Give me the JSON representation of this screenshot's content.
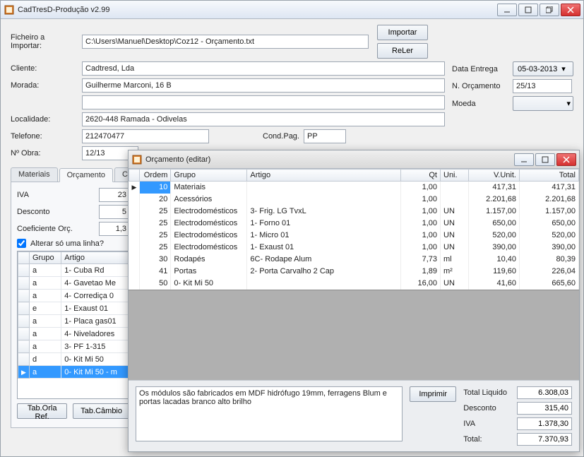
{
  "main": {
    "title": "CadTresD-Produção v2.99",
    "import_label": "Ficheiro a Importar:",
    "import_path": "C:\\Users\\Manuel\\Desktop\\Coz12 - Orçamento.txt",
    "btn_import": "Importar",
    "btn_reler": "ReLer",
    "labels": {
      "cliente": "Cliente:",
      "morada": "Morada:",
      "localidade": "Localidade:",
      "telefone": "Telefone:",
      "nobra": "Nº Obra:",
      "condpag": "Cond.Pag.",
      "data_entrega": "Data Entrega",
      "n_orcamento": "N. Orçamento",
      "moeda": "Moeda"
    },
    "fields": {
      "cliente": "Cadtresd, Lda",
      "morada1": "Guilherme Marconi, 16 B",
      "morada2": "",
      "localidade": "2620-448 Ramada - Odivelas",
      "telefone": "212470477",
      "condpag": "PP",
      "nobra": "12/13",
      "data_entrega": "05-03-2013",
      "n_orcamento": "25/13",
      "moeda": ""
    },
    "tabs": [
      "Materiais",
      "Orçamento",
      "Compor"
    ],
    "orc_panel": {
      "iva_label": "IVA",
      "iva": "23",
      "desconto_label": "Desconto",
      "desconto": "5",
      "coef_label": "Coeficiente Orç.",
      "coef": "1,3",
      "alterar_label": "Alterar só uma linha?",
      "cols": [
        "Grupo",
        "Artigo"
      ],
      "rows": [
        {
          "grupo": "a",
          "artigo": "1- Cuba Rd"
        },
        {
          "grupo": "a",
          "artigo": "4- Gavetao Me"
        },
        {
          "grupo": "a",
          "artigo": "4- Corrediça 0"
        },
        {
          "grupo": "e",
          "artigo": "1- Exaust 01"
        },
        {
          "grupo": "a",
          "artigo": "1- Placa gas01"
        },
        {
          "grupo": "a",
          "artigo": "4- Niveladores"
        },
        {
          "grupo": "a",
          "artigo": "3- PF 1-315"
        },
        {
          "grupo": "d",
          "artigo": "0- Kit Mi 50"
        },
        {
          "grupo": "a",
          "artigo": "0- Kit Mi 50 - m",
          "sel": true
        }
      ],
      "btn_tab_orla": "Tab.Orla Ref.",
      "btn_tab_cambio": "Tab.Câmbio"
    }
  },
  "sub": {
    "title": "Orçamento (editar)",
    "cols": {
      "ordem": "Ordem",
      "grupo": "Grupo",
      "artigo": "Artigo",
      "qt": "Qt",
      "uni": "Uni.",
      "vunit": "V.Unit.",
      "total": "Total"
    },
    "rows": [
      {
        "ordem": "10",
        "grupo": "Materiais",
        "artigo": "",
        "qt": "1,00",
        "uni": "",
        "vunit": "417,31",
        "total": "417,31",
        "sel": true
      },
      {
        "ordem": "20",
        "grupo": "Acessórios",
        "artigo": "",
        "qt": "1,00",
        "uni": "",
        "vunit": "2.201,68",
        "total": "2.201,68"
      },
      {
        "ordem": "25",
        "grupo": "Electrodomésticos",
        "artigo": "3- Frig. LG TvxL",
        "qt": "1,00",
        "uni": "UN",
        "vunit": "1.157,00",
        "total": "1.157,00"
      },
      {
        "ordem": "25",
        "grupo": "Electrodomésticos",
        "artigo": "1- Forno 01",
        "qt": "1,00",
        "uni": "UN",
        "vunit": "650,00",
        "total": "650,00"
      },
      {
        "ordem": "25",
        "grupo": "Electrodomésticos",
        "artigo": "1- Micro 01",
        "qt": "1,00",
        "uni": "UN",
        "vunit": "520,00",
        "total": "520,00"
      },
      {
        "ordem": "25",
        "grupo": "Electrodomésticos",
        "artigo": "1- Exaust 01",
        "qt": "1,00",
        "uni": "UN",
        "vunit": "390,00",
        "total": "390,00"
      },
      {
        "ordem": "30",
        "grupo": "Rodapés",
        "artigo": "6C- Rodape Alum",
        "qt": "7,73",
        "uni": "ml",
        "vunit": "10,40",
        "total": "80,39"
      },
      {
        "ordem": "41",
        "grupo": "Portas",
        "artigo": "2- Porta Carvalho 2 Cap",
        "qt": "1,89",
        "uni": "m²",
        "vunit": "119,60",
        "total": "226,04"
      },
      {
        "ordem": "50",
        "grupo": "0- Kit Mi 50",
        "artigo": "",
        "qt": "16,00",
        "uni": "UN",
        "vunit": "41,60",
        "total": "665,60"
      }
    ],
    "notes": "Os módulos são fabricados em MDF hidrófugo 19mm, ferragens Blum e portas lacadas branco alto brilho",
    "btn_print": "Imprimir",
    "totals": {
      "tl_label": "Total Liquido",
      "tl": "6.308,03",
      "d_label": "Desconto",
      "d": "315,40",
      "iva_label": "IVA",
      "iva": "1.378,30",
      "tot_label": "Total:",
      "tot": "7.370,93"
    }
  }
}
